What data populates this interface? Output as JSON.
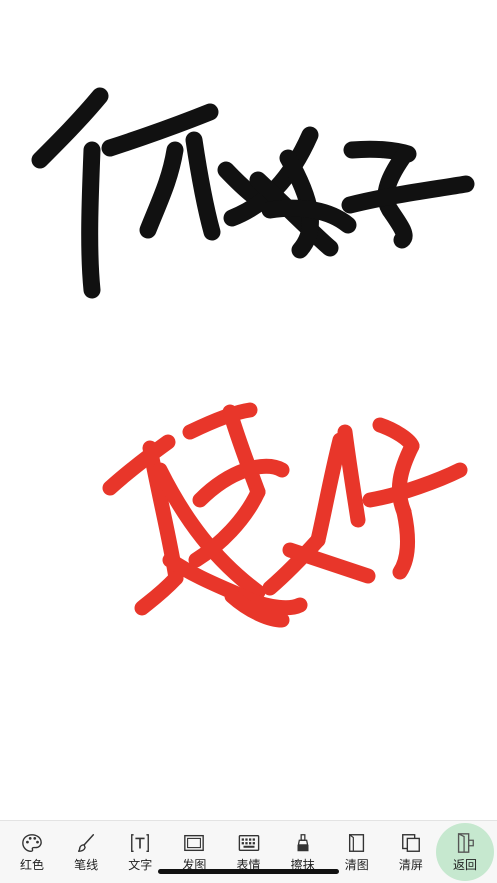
{
  "canvas": {
    "strokes_black": "#111111",
    "strokes_red": "#e8362a"
  },
  "toolbar": {
    "items": [
      {
        "label": "红色",
        "icon": "palette-icon"
      },
      {
        "label": "笔线",
        "icon": "brush-icon"
      },
      {
        "label": "文字",
        "icon": "text-icon"
      },
      {
        "label": "发图",
        "icon": "send-image-icon"
      },
      {
        "label": "表情",
        "icon": "keyboard-icon"
      },
      {
        "label": "擦抹",
        "icon": "eraser-icon"
      },
      {
        "label": "清图",
        "icon": "clear-image-icon"
      },
      {
        "label": "清屏",
        "icon": "clear-screen-icon"
      },
      {
        "label": "返回",
        "icon": "exit-door-icon"
      }
    ],
    "active_index": 8,
    "active_color": "#c6e8cf"
  }
}
